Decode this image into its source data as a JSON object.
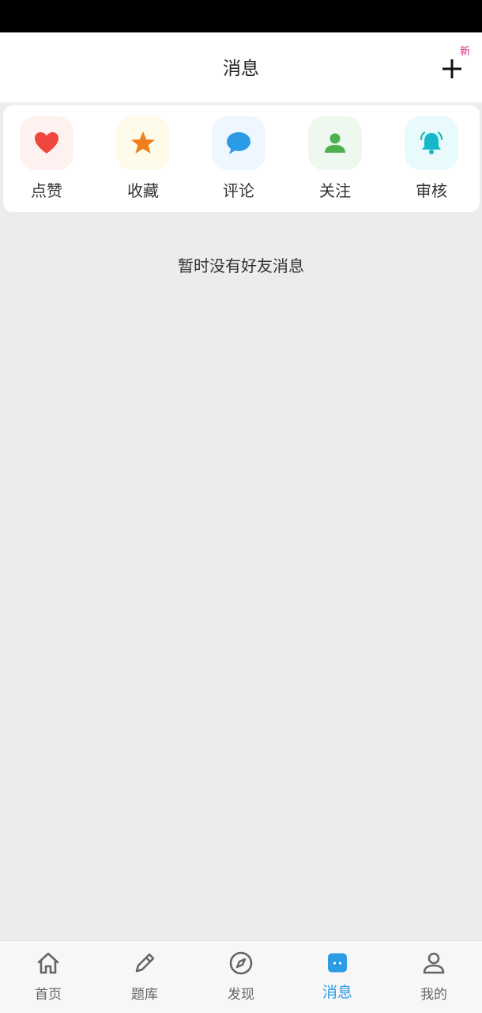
{
  "header": {
    "title": "消息",
    "new_badge": "新"
  },
  "shortcuts": [
    {
      "label": "点赞",
      "icon": "heart-icon",
      "color": "#f0473d",
      "bg": "#fff1f0"
    },
    {
      "label": "收藏",
      "icon": "star-icon",
      "color": "#f07e1b",
      "bg": "#fffbea"
    },
    {
      "label": "评论",
      "icon": "speech-bubble-icon",
      "color": "#2b9be6",
      "bg": "#eef7ff"
    },
    {
      "label": "关注",
      "icon": "person-icon",
      "color": "#4caf50",
      "bg": "#eef8ee"
    },
    {
      "label": "审核",
      "icon": "bell-icon",
      "color": "#14b8c8",
      "bg": "#e8fafb"
    }
  ],
  "empty_message": "暂时没有好友消息",
  "tabbar": {
    "tabs": [
      {
        "label": "首页",
        "icon": "home-icon",
        "active": false
      },
      {
        "label": "题库",
        "icon": "pencil-icon",
        "active": false
      },
      {
        "label": "发现",
        "icon": "compass-icon",
        "active": false
      },
      {
        "label": "消息",
        "icon": "chat-icon",
        "active": true
      },
      {
        "label": "我的",
        "icon": "user-icon",
        "active": false
      }
    ],
    "active_color": "#2b9be6",
    "inactive_color": "#666666"
  }
}
